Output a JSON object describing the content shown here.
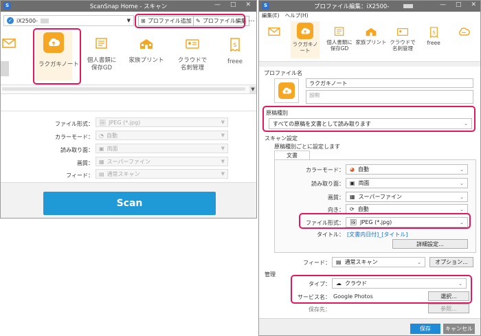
{
  "left": {
    "title": "ScanSnap Home - スキャン",
    "device": "iX2500-",
    "add_profile": "プロファイル追加",
    "edit_profile": "プロファイル編集",
    "more": "…",
    "profiles": [
      {
        "label": "",
        "icon": "mail-icon"
      },
      {
        "label": "ラクガキノート",
        "icon": "cloud-upload-icon"
      },
      {
        "label": "個人書類に\n保存GD",
        "icon": "document-folder-icon"
      },
      {
        "label": "家族プリント",
        "icon": "school-icon"
      },
      {
        "label": "クラウドで\n名刺管理",
        "icon": "business-card-icon"
      },
      {
        "label": "freee",
        "icon": "receipt-icon"
      }
    ],
    "settings": [
      {
        "label": "ファイル形式：",
        "value": "JPEG (*.jpg)",
        "icon": "image-file-icon"
      },
      {
        "label": "カラーモード：",
        "value": "自動",
        "icon": "color-wheel-icon"
      },
      {
        "label": "読み取り面：",
        "value": "両面",
        "icon": "duplex-icon"
      },
      {
        "label": "画質：",
        "value": "スーパーファイン",
        "icon": "checker-icon"
      },
      {
        "label": "フィード：",
        "value": "通常スキャン",
        "icon": "feed-icon"
      }
    ],
    "scan_button": "Scan"
  },
  "right": {
    "title": "プロファイル編集：iX2500-",
    "menu": [
      "編集(E)",
      "ヘルプ(H)"
    ],
    "profiles": [
      {
        "label": "",
        "icon": "mail-icon"
      },
      {
        "label": "ラクガキノ\nート",
        "icon": "cloud-upload-icon"
      },
      {
        "label": "個人書類に\n保存GD",
        "icon": "document-folder-icon"
      },
      {
        "label": "家族プリント",
        "icon": "school-icon"
      },
      {
        "label": "クラウドで\n名刺管理",
        "icon": "business-card-icon"
      },
      {
        "label": "freee",
        "icon": "receipt-icon"
      }
    ],
    "profile_name_label": "プロファイル名",
    "profile_name": "ラクガキノート",
    "description_placeholder": "説明",
    "doc_type_label": "原稿種別",
    "doc_type_value": "すべての原稿を文書として読み取ります",
    "scan_settings_label": "スキャン設定",
    "per_type_label": "原稿種別ごとに設定します",
    "tab_document": "文書",
    "color_mode_label": "カラーモード：",
    "color_mode": "自動",
    "scan_side_label": "読み取り面：",
    "scan_side": "両面",
    "quality_label": "画質：",
    "quality": "スーパーファイン",
    "orientation_label": "向き：",
    "orientation": "自動",
    "file_format_label": "ファイル形式：",
    "file_format": "JPEG (*.jpg)",
    "title_label": "タイトル：",
    "title_value": "[文書内日付]_[タイトル]",
    "detail_button": "詳細設定...",
    "feed_label": "フィード：",
    "feed_value": "通常スキャン",
    "option_button": "オプション...",
    "manage_label": "管理",
    "type_label": "タイプ：",
    "type_value": "クラウド",
    "service_label": "サービス名：",
    "service_value": "Google Photos",
    "select_button": "選択...",
    "save_to_label": "保存先：",
    "browse_button": "参照...",
    "save_button": "保存",
    "cancel_button": "キャンセル"
  },
  "colors": {
    "titlebar": "#6e6e6e",
    "accent": "#f5a623",
    "scan": "#1f9ad6",
    "highlight": "#e4165e",
    "save": "#1f8ad6"
  }
}
